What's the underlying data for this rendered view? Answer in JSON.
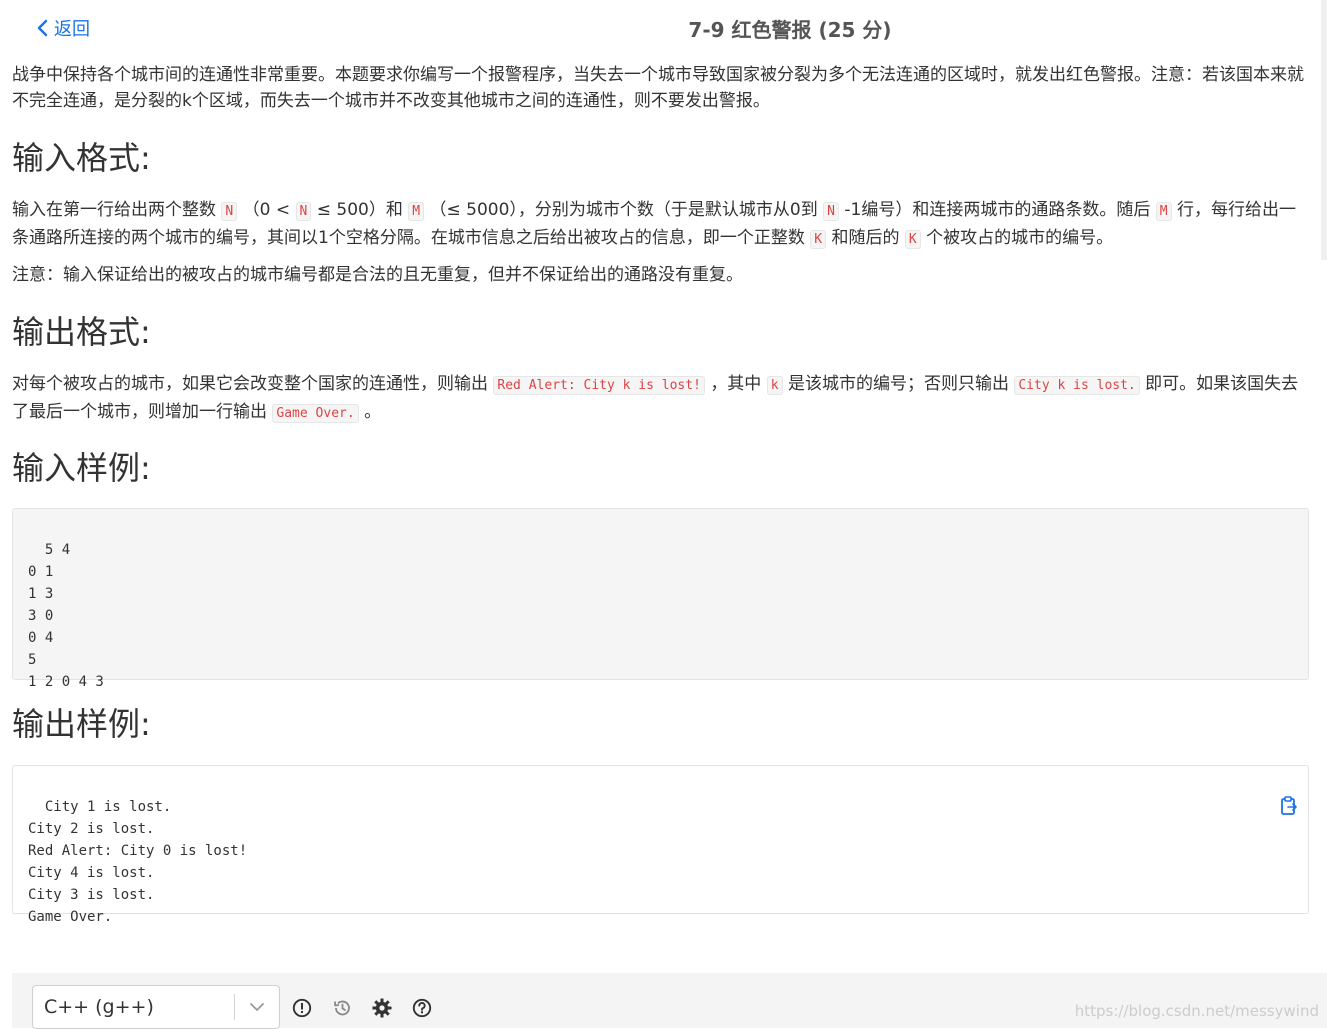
{
  "header": {
    "back_label": "返回",
    "title": "7-9 红色警报 (25 分)"
  },
  "description": "战争中保持各个城市间的连通性非常重要。本题要求你编写一个报警程序，当失去一个城市导致国家被分裂为多个无法连通的区域时，就发出红色警报。注意：若该国本来就不完全连通，是分裂的k个区域，而失去一个城市并不改变其他城市之间的连通性，则不要发出警报。",
  "input_format": {
    "heading": "输入格式:",
    "p1": [
      "输入在第一行给出两个整数",
      "N",
      "（0 < ",
      "N",
      " ≤ 500）和",
      "M",
      "（≤ 5000），分别为城市个数（于是默认城市从0到",
      "N",
      "-1编号）和连接两城市的通路条数。随后",
      "M",
      "行，每行给出一条通路所连接的两个城市的编号，其间以1个空格分隔。在城市信息之后给出被攻占的信息，即一个正整数",
      "K",
      "和随后的",
      "K",
      "个被攻占的城市的编号。"
    ],
    "p2": "注意：输入保证给出的被攻占的城市编号都是合法的且无重复，但并不保证给出的通路没有重复。"
  },
  "output_format": {
    "heading": "输出格式:",
    "p1": [
      "对每个被攻占的城市，如果它会改变整个国家的连通性，则输出",
      "Red Alert: City k is lost!",
      "，其中",
      "k",
      "是该城市的编号；否则只输出",
      "City k is lost.",
      "即可。如果该国失去了最后一个城市，则增加一行输出",
      "Game Over.",
      "。"
    ]
  },
  "sample_input": {
    "heading": "输入样例:",
    "code": "5 4\n0 1\n1 3\n3 0\n0 4\n5\n1 2 0 4 3"
  },
  "sample_output": {
    "heading": "输出样例:",
    "code": "City 1 is lost.\nCity 2 is lost.\nRed Alert: City 0 is lost!\nCity 4 is lost.\nCity 3 is lost.\nGame Over.",
    "copy_icon": "clipboard-icon"
  },
  "toolbar": {
    "language": "C++ (g++)",
    "icons": [
      "info-icon",
      "history-icon",
      "gear-icon",
      "help-icon"
    ]
  },
  "watermark": "https://blog.csdn.net/messywind",
  "colors": {
    "accent": "#1a73e8",
    "inline_code": "#dd4444"
  }
}
